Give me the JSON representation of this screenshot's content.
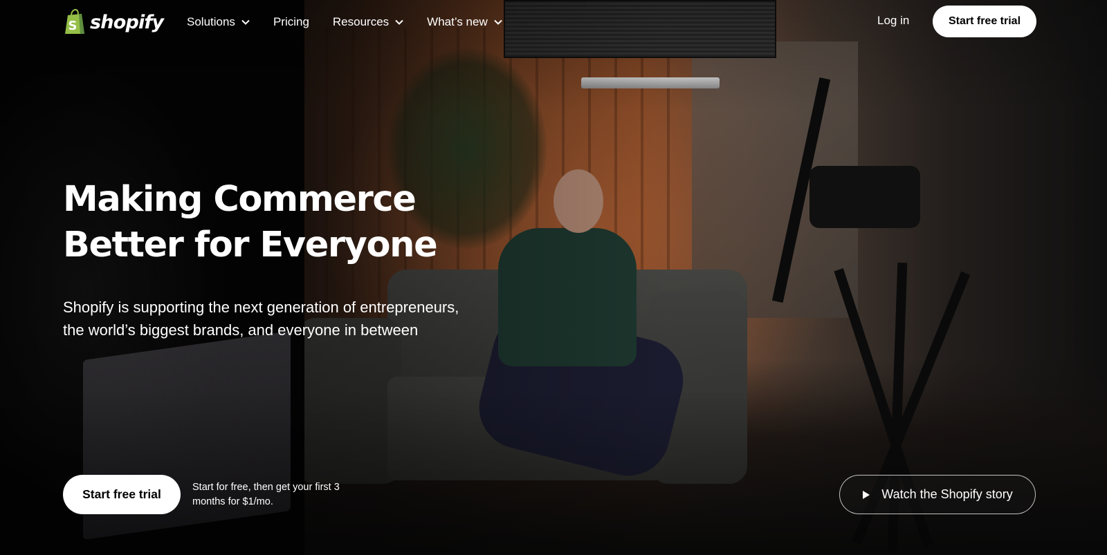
{
  "brand": {
    "name": "shopify",
    "logo_icon": "shopify-bag-icon",
    "bag_color": "#95BF47",
    "bag_letter": "S"
  },
  "nav": {
    "items": [
      {
        "label": "Solutions",
        "has_dropdown": true
      },
      {
        "label": "Pricing",
        "has_dropdown": false
      },
      {
        "label": "Resources",
        "has_dropdown": true
      },
      {
        "label": "What’s new",
        "has_dropdown": true
      }
    ],
    "login_label": "Log in",
    "cta_label": "Start free trial"
  },
  "hero": {
    "title_line1": "Making Commerce",
    "title_line2": "Better for Everyone",
    "subtitle": "Shopify is supporting the next generation of entrepreneurs, the world’s biggest brands, and everyone in between",
    "cta_label": "Start free trial",
    "cta_note": "Start for free, then get your first 3 months for $1/mo.",
    "watch_label": "Watch the Shopify story",
    "watch_icon": "play-icon"
  },
  "colors": {
    "text": "#FFFFFF",
    "button_bg": "#FFFFFF",
    "button_text": "#000000",
    "brand_green": "#95BF47"
  }
}
